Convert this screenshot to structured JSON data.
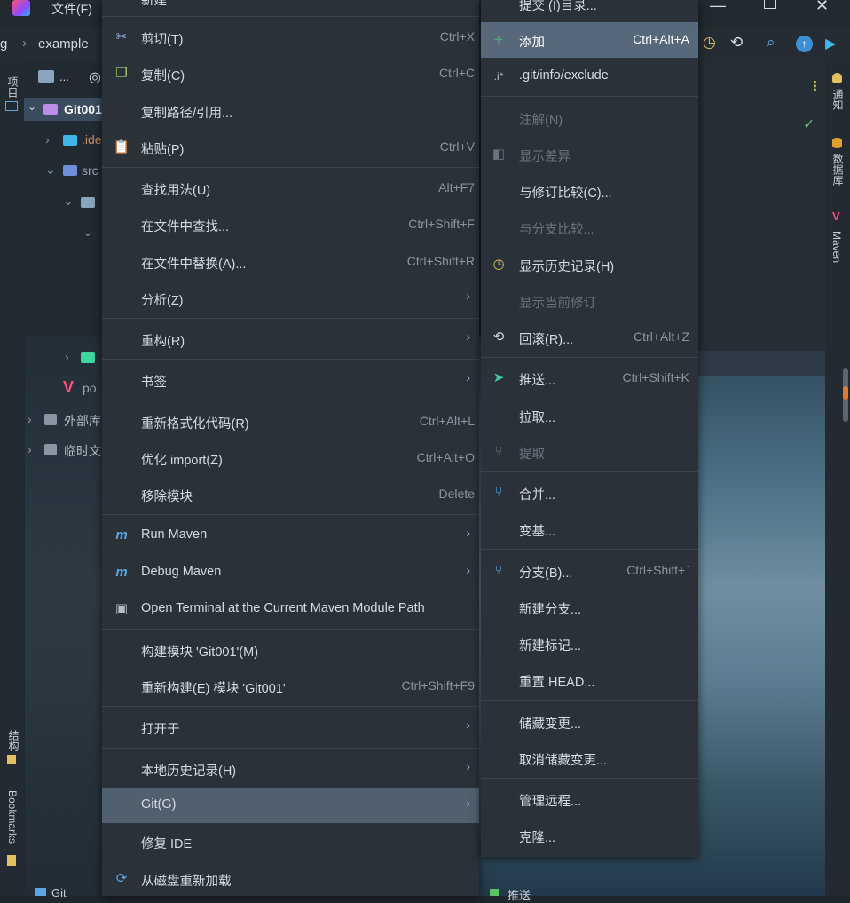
{
  "titlebar": {
    "menu_file": "文件(F)"
  },
  "navbar": {
    "left_text": "g",
    "breadcrumb": "example"
  },
  "left_strip": {
    "project_tab": "项目",
    "structure_tab": "结构",
    "bookmarks_tab": "Bookmarks"
  },
  "right_strip": {
    "notifications_tab": "通知",
    "database_tab": "数据库",
    "maven_tab": "Maven"
  },
  "project_panel": {
    "toolbar_dots": "...",
    "root": "Git001",
    "idea_node": ".ide",
    "src_node": "src",
    "pom_node": "po",
    "ext_libs": "外部库",
    "scratch": "临时文"
  },
  "bottom_tabs": {
    "git": "Git",
    "changes": "推送"
  },
  "context_menu": {
    "top_partial": "新建",
    "items": [
      {
        "label": "剪切(T)",
        "shortcut": "Ctrl+X",
        "icon": "scissors-icon"
      },
      {
        "label": "复制(C)",
        "shortcut": "Ctrl+C",
        "icon": "copy-icon"
      },
      {
        "label": "复制路径/引用...",
        "shortcut": "",
        "icon": ""
      },
      {
        "label": "粘贴(P)",
        "shortcut": "Ctrl+V",
        "icon": "paste-icon"
      },
      {
        "label": "查找用法(U)",
        "shortcut": "Alt+F7",
        "icon": ""
      },
      {
        "label": "在文件中查找...",
        "shortcut": "Ctrl+Shift+F",
        "icon": ""
      },
      {
        "label": "在文件中替换(A)...",
        "shortcut": "Ctrl+Shift+R",
        "icon": ""
      },
      {
        "label": "分析(Z)",
        "shortcut": "",
        "icon": "",
        "submenu": true
      },
      {
        "label": "重构(R)",
        "shortcut": "",
        "icon": "",
        "submenu": true
      },
      {
        "label": "书签",
        "shortcut": "",
        "icon": "",
        "submenu": true
      },
      {
        "label": "重新格式化代码(R)",
        "shortcut": "Ctrl+Alt+L",
        "icon": ""
      },
      {
        "label": "优化 import(Z)",
        "shortcut": "Ctrl+Alt+O",
        "icon": ""
      },
      {
        "label": "移除模块",
        "shortcut": "Delete",
        "icon": ""
      },
      {
        "label": "Run Maven",
        "shortcut": "",
        "icon": "maven-run-icon",
        "submenu": true
      },
      {
        "label": "Debug Maven",
        "shortcut": "",
        "icon": "maven-debug-icon",
        "submenu": true
      },
      {
        "label": "Open Terminal at the Current Maven Module Path",
        "shortcut": "",
        "icon": "terminal-icon"
      },
      {
        "label": "构建模块 'Git001'(M)",
        "shortcut": "",
        "icon": ""
      },
      {
        "label": "重新构建(E) 模块 'Git001'",
        "shortcut": "Ctrl+Shift+F9",
        "icon": ""
      },
      {
        "label": "打开于",
        "shortcut": "",
        "icon": "",
        "submenu": true
      },
      {
        "label": "本地历史记录(H)",
        "shortcut": "",
        "icon": "",
        "submenu": true
      },
      {
        "label": "Git(G)",
        "shortcut": "",
        "icon": "",
        "submenu": true
      },
      {
        "label": "修复 IDE",
        "shortcut": "",
        "icon": ""
      },
      {
        "label": "从磁盘重新加载",
        "shortcut": "",
        "icon": "reload-icon"
      }
    ]
  },
  "git_submenu": {
    "top_partial": "提交 (I)目录...",
    "items": [
      {
        "label": "添加",
        "shortcut": "Ctrl+Alt+A",
        "icon": "plus-icon"
      },
      {
        "label": ".git/info/exclude",
        "shortcut": "",
        "icon": "ignore-icon"
      },
      {
        "label": "注解(N)",
        "shortcut": "",
        "icon": ""
      },
      {
        "label": "显示差异",
        "shortcut": "",
        "icon": "diff-icon"
      },
      {
        "label": "与修订比较(C)...",
        "shortcut": "",
        "icon": ""
      },
      {
        "label": "与分支比较...",
        "shortcut": "",
        "icon": ""
      },
      {
        "label": "显示历史记录(H)",
        "shortcut": "",
        "icon": "history-icon"
      },
      {
        "label": "显示当前修订",
        "shortcut": "",
        "icon": ""
      },
      {
        "label": "回滚(R)...",
        "shortcut": "Ctrl+Alt+Z",
        "icon": "rollback-icon"
      },
      {
        "label": "推送...",
        "shortcut": "Ctrl+Shift+K",
        "icon": "push-icon"
      },
      {
        "label": "拉取...",
        "shortcut": "",
        "icon": ""
      },
      {
        "label": "提取",
        "shortcut": "",
        "icon": "fetch-icon"
      },
      {
        "label": "合并...",
        "shortcut": "",
        "icon": "merge-icon"
      },
      {
        "label": "变基...",
        "shortcut": "",
        "icon": ""
      },
      {
        "label": "分支(B)...",
        "shortcut": "Ctrl+Shift+`",
        "icon": "branch-icon"
      },
      {
        "label": "新建分支...",
        "shortcut": "",
        "icon": ""
      },
      {
        "label": "新建标记...",
        "shortcut": "",
        "icon": ""
      },
      {
        "label": "重置 HEAD...",
        "shortcut": "",
        "icon": ""
      },
      {
        "label": "储藏变更...",
        "shortcut": "",
        "icon": ""
      },
      {
        "label": "取消储藏变更...",
        "shortcut": "",
        "icon": ""
      },
      {
        "label": "管理远程...",
        "shortcut": "",
        "icon": ""
      },
      {
        "label": "克隆...",
        "shortcut": "",
        "icon": ""
      }
    ]
  },
  "colors": {
    "accent_blue": "#3d8fd6",
    "menu_bg": "#2a3138",
    "hover_bg": "#56687a",
    "green": "#4caf7a"
  }
}
